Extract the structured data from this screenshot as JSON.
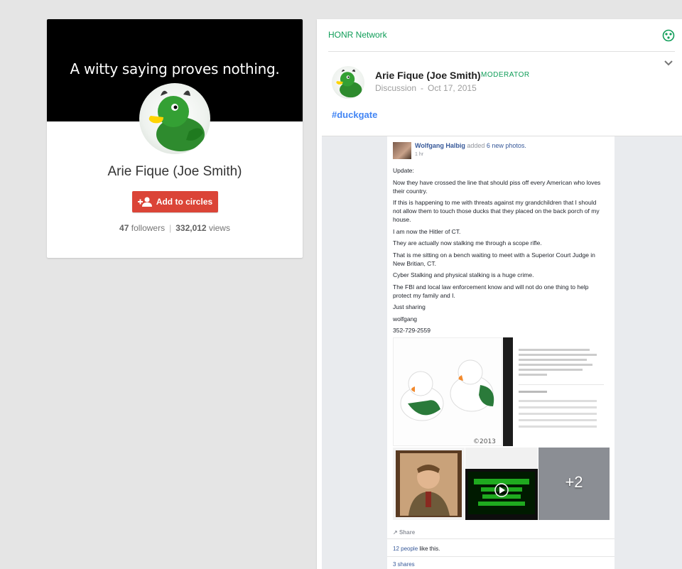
{
  "colors": {
    "accent_red": "#db4437",
    "community_green": "#0f9d58",
    "hashtag_blue": "#4285f4",
    "fb_link": "#365899"
  },
  "profile": {
    "cover_text": "A witty saying proves nothing.",
    "name": "Arie Fique (Joe Smith)",
    "add_button": "Add to circles",
    "followers_count": "47",
    "followers_label": "followers",
    "views_count": "332,012",
    "views_label": "views",
    "add_icon": "person-add-icon"
  },
  "post": {
    "community": "HONR Network",
    "community_icon": "community-icon",
    "author": "Arie Fique (Joe Smith)",
    "role_badge": "MODERATOR",
    "category": "Discussion",
    "date": "Oct 17, 2015",
    "hashtag": "#duckgate"
  },
  "embed": {
    "poster": "Wolfgang Halbig",
    "action_text": "added",
    "photo_link": "6 new photos.",
    "time": "1 hr",
    "paragraphs": [
      "Update:",
      "Now they have crossed the line that should piss off every American who loves their country.",
      "If this is happening to me with threats against my grandchildren that I should not allow them to touch those ducks that they placed on the back porch of my house.",
      "I am now the Hitler of CT.",
      "They are actually now stalking me through a scope rifle.",
      "That is me sitting on a bench waiting to meet with a Superior Court Judge in New Britian, CT.",
      "Cyber Stalking and physical stalking is a huge crime.",
      "The FBI and local law enforcement know and will not do one thing to help protect my family and I.",
      "Just sharing",
      "wolfgang",
      "352-729-2559"
    ],
    "photo_watermark": "©2013",
    "photo_more": "+2",
    "share_label": "Share",
    "likes_link": "12 people",
    "likes_suffix": "like this.",
    "shares": "3 shares"
  }
}
